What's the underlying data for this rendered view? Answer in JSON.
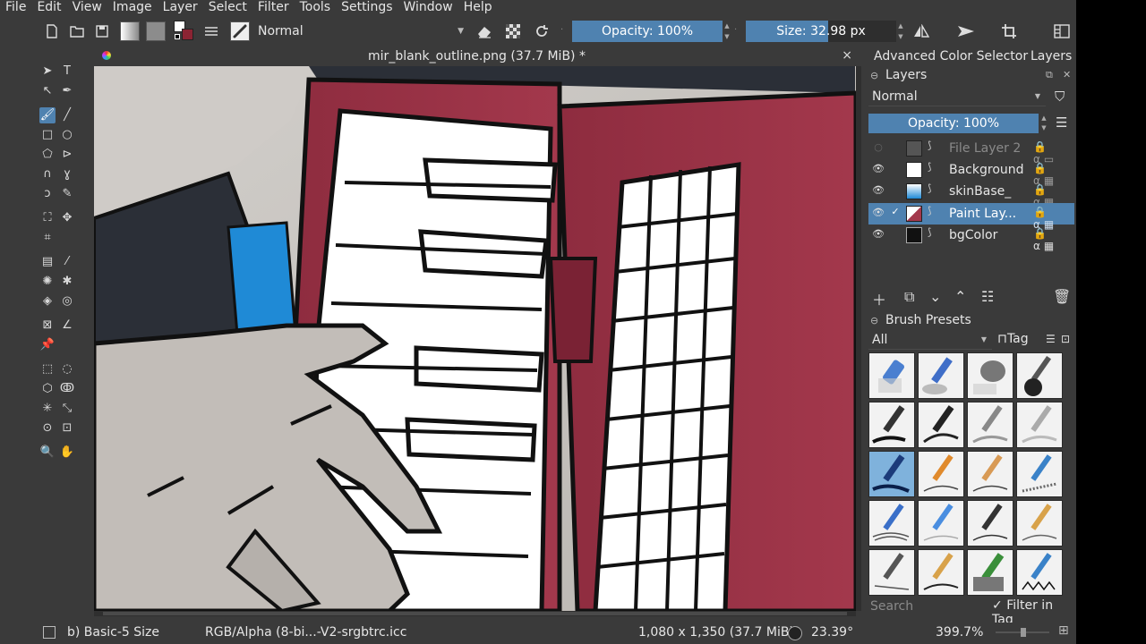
{
  "menubar": {
    "items": [
      "File",
      "Edit",
      "View",
      "Image",
      "Layer",
      "Select",
      "Filter",
      "Tools",
      "Settings",
      "Window",
      "Help"
    ]
  },
  "toolbar": {
    "blend_mode": "Normal",
    "opacity_label": "Opacity: 100%",
    "opacity_fraction": 1.0,
    "size_label": "Size: 32.98 px",
    "size_fraction": 0.55
  },
  "document": {
    "tab_title": "mir_blank_outline.png (37.7 MiB) *",
    "close_glyph": "×"
  },
  "dock": {
    "tabs": [
      "Advanced Color Selector",
      "Layers"
    ],
    "layers_title": "Layers",
    "blend_mode": "Normal",
    "opacity_label": "Opacity:  100%",
    "layers": [
      {
        "name": "File Layer 2",
        "visible": false,
        "selected": false,
        "disabled": true
      },
      {
        "name": "Background",
        "visible": true,
        "selected": false,
        "disabled": false
      },
      {
        "name": "skinBase_",
        "visible": true,
        "selected": false,
        "disabled": false
      },
      {
        "name": "Paint Lay...",
        "visible": true,
        "selected": true,
        "disabled": false
      },
      {
        "name": "bgColor",
        "visible": true,
        "selected": false,
        "disabled": false
      }
    ],
    "brush_presets_title": "Brush Presets",
    "preset_filter": "All",
    "tag_label": "Tag",
    "search_placeholder": "Search",
    "filter_in_tag": "Filter in Tag"
  },
  "status": {
    "brush": "b) Basic-5 Size",
    "color_profile": "RGB/Alpha (8-bi...-V2-srgbtrc.icc",
    "dimensions": "1,080 x 1,350 (37.7 MiB)",
    "rotation": "23.39°",
    "zoom": "399.7%"
  }
}
